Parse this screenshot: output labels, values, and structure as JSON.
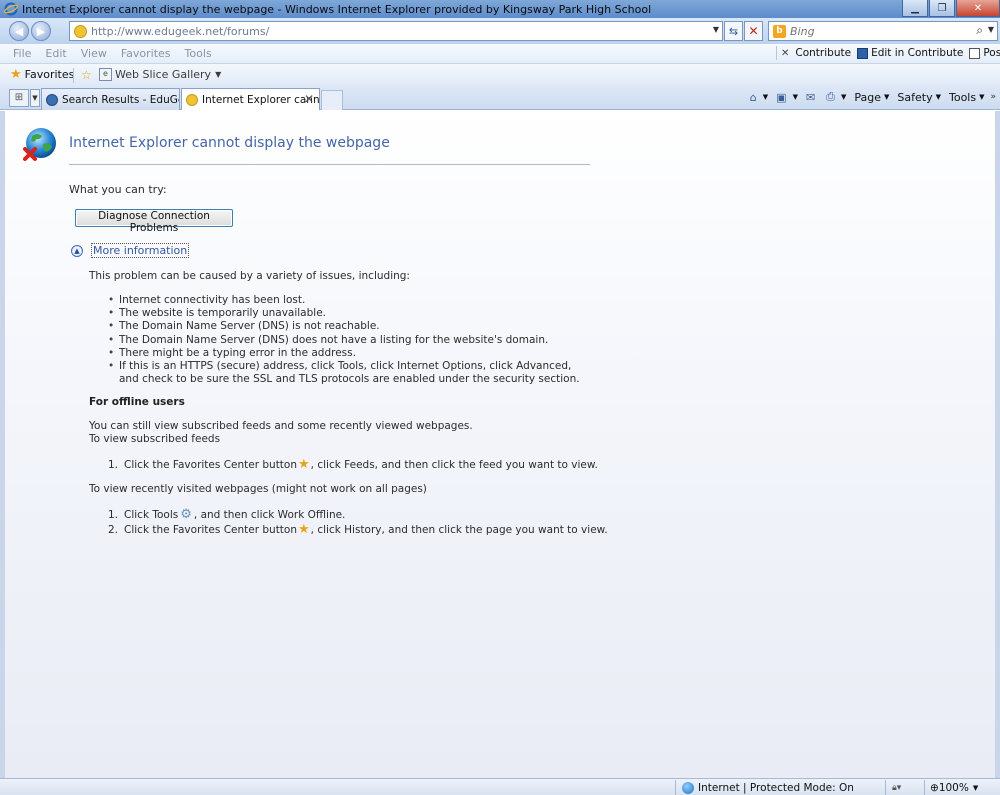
{
  "window": {
    "title": "Internet Explorer cannot display the webpage - Windows Internet Explorer provided by Kingsway Park High School"
  },
  "address": {
    "url": "http://www.edugeek.net/forums/",
    "search_placeholder": "Bing"
  },
  "menu": {
    "items": [
      "File",
      "Edit",
      "View",
      "Favorites",
      "Tools"
    ]
  },
  "contribute": {
    "contribute_label": "Contribute",
    "edit_label": "Edit in Contribute",
    "post_label": "Post to Blo"
  },
  "favorites": {
    "label": "Favorites",
    "web_slice_label": "Web Slice Gallery"
  },
  "tabs": [
    {
      "label": "Search Results - EduGeek...."
    },
    {
      "label": "Internet Explorer canno..."
    }
  ],
  "commandbar": {
    "page_label": "Page",
    "safety_label": "Safety",
    "tools_label": "Tools"
  },
  "content": {
    "title": "Internet Explorer cannot display the webpage",
    "try_label": "What you can try:",
    "diagnose_label": "Diagnose Connection Problems",
    "more_info_label": "More information",
    "cause_intro": "This problem can be caused by a variety of issues, including:",
    "causes": [
      "Internet connectivity has been lost.",
      "The website is temporarily unavailable.",
      "The Domain Name Server (DNS) is not reachable.",
      "The Domain Name Server (DNS) does not have a listing for the website's domain.",
      "There might be a typing error in the address.",
      "If this is an HTTPS (secure) address, click Tools, click Internet Options, click Advanced, and check to be sure the SSL and TLS protocols are enabled under the security section."
    ],
    "offline_heading": "For offline users",
    "offline_text1": "You can still view subscribed feeds and some recently viewed webpages.",
    "offline_text2": "To view subscribed feeds",
    "feeds_step": {
      "num": "1.",
      "before": "Click the Favorites Center button",
      "after": ", click Feeds, and then click the feed you want to view."
    },
    "recent_text": "To view recently visited webpages (might not work on all pages)",
    "tools_step": {
      "num": "1.",
      "before": "Click Tools",
      "after": ", and then click Work Offline."
    },
    "history_step": {
      "num": "2.",
      "before": "Click the Favorites Center button",
      "after": ", click History, and then click the page you want to view."
    }
  },
  "status": {
    "zone_label": "Internet | Protected Mode: On",
    "zoom_label": "100%"
  },
  "colors": {
    "title_blue": "#4466a8",
    "link_blue": "#3456a0",
    "button_border": "#3c7fb1"
  }
}
